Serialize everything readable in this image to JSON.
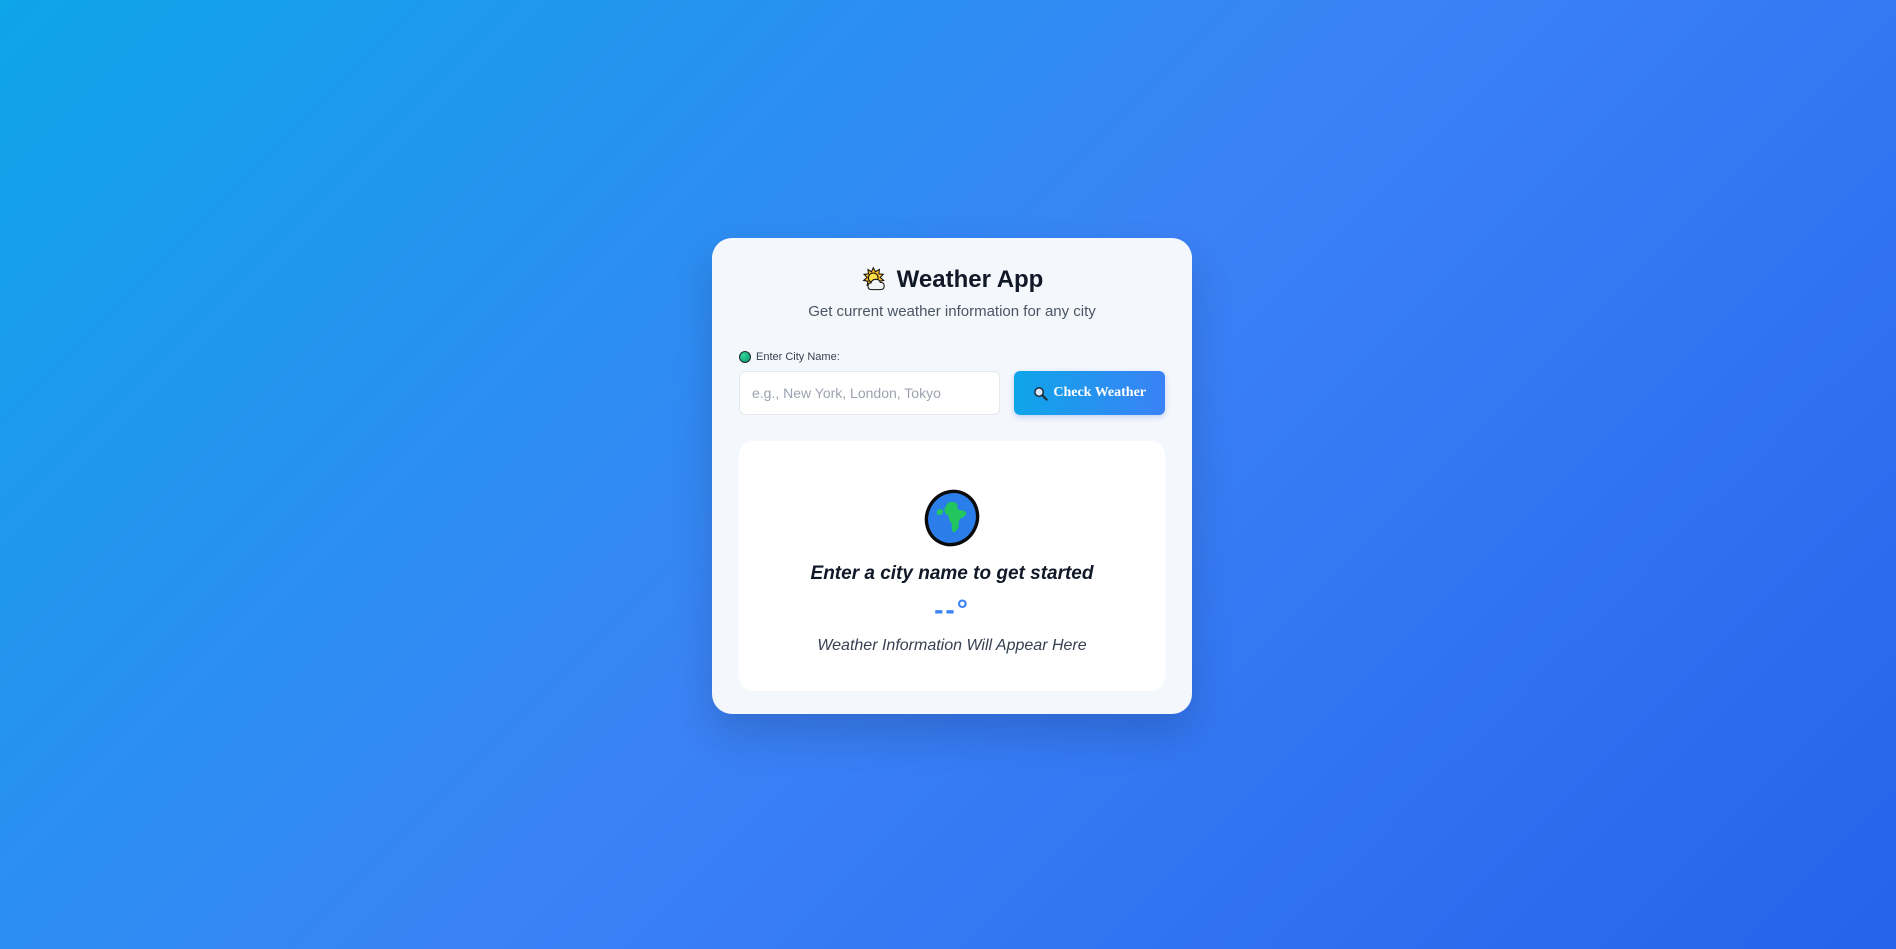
{
  "app": {
    "title": "Weather App",
    "title_icon": "sun-behind-cloud-icon",
    "subtitle": "Get current weather information for any city"
  },
  "form": {
    "label": "Enter City Name:",
    "label_icon": "green-circle-icon",
    "input_placeholder": "e.g., New York, London, Tokyo",
    "input_value": "",
    "button_label": "Check Weather",
    "button_icon": "search-icon"
  },
  "result": {
    "icon": "globe-icon",
    "title": "Enter a city name to get started",
    "temperature": "--°",
    "description": "Weather Information Will Appear Here"
  },
  "colors": {
    "background_start": "#0ea5e9",
    "background_end": "#2563eb",
    "accent": "#3b82f6",
    "card": "#f4f7fb",
    "panel": "#ffffff",
    "text_primary": "#111827",
    "text_secondary": "#4b5563"
  }
}
